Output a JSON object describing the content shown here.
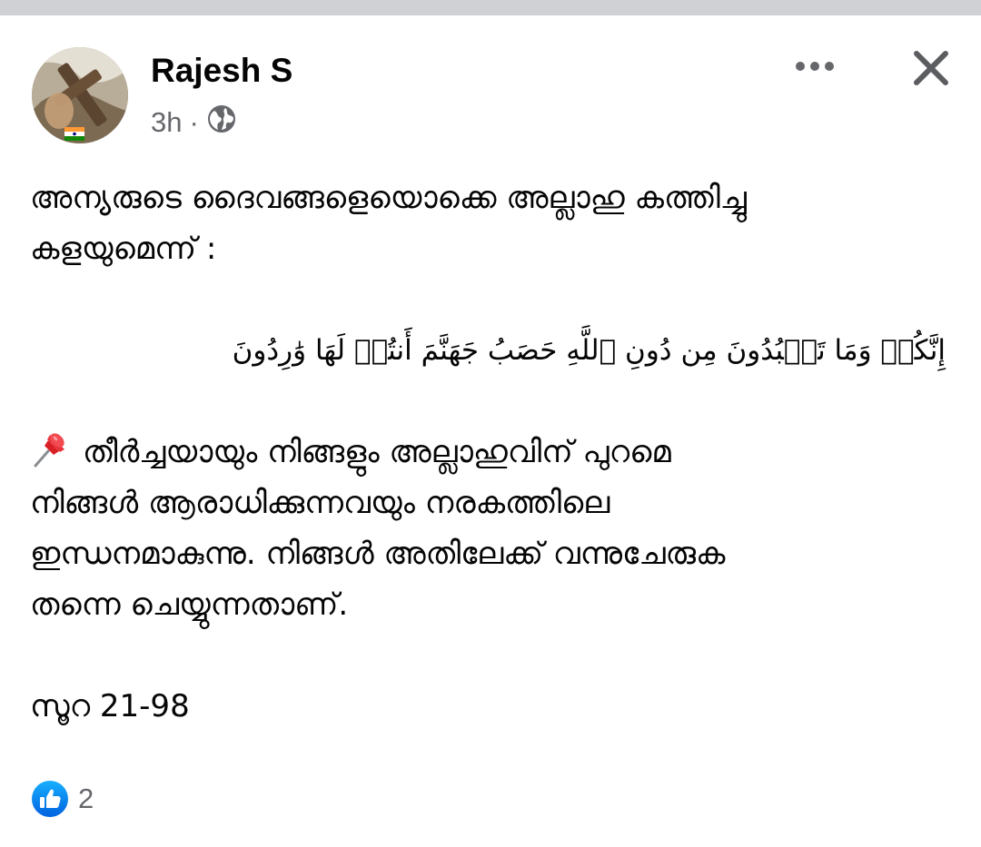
{
  "post": {
    "author": "Rajesh S",
    "time": "3h",
    "separator": "·",
    "audience_icon": "globe-icon",
    "paragraphs": {
      "intro_line1": "അന്യരുടെ ദൈവങ്ങളെയൊക്കെ അല്ലാഹു കത്തിച്ചു",
      "intro_line2": "കളയുമെന്ന് :",
      "arabic": "إِنَّكُمۡ وَمَا تَعۡبُدُونَ مِن دُونِ ٱللَّهِ حَصَبُ جَهَنَّمَ أَنتُمۡ لَهَا وَٰرِدُونَ",
      "pin_icon": "pushpin-icon",
      "translation_line1": "തീർച്ചയായും നിങ്ങളും അല്ലാഹുവിന് പുറമെ",
      "translation_line2": "നിങ്ങൾ ആരാധിക്കുന്നവയും നരകത്തിലെ",
      "translation_line3": "ഇന്ധനമാകുന്നു. നിങ്ങൾ അതിലേക്ക് വന്നുചേരുക",
      "translation_line4": "തന്നെ ചെയ്യുന്നതാണ്.",
      "reference": "സൂറ 21-98"
    }
  },
  "header_actions": {
    "more_icon": "more-options-icon",
    "close_icon": "close-icon"
  },
  "reactions": {
    "icon": "like-icon",
    "count": "2"
  },
  "colors": {
    "like_blue": "#1877f2",
    "secondary_text": "#65676b",
    "primary_text": "#050505",
    "top_strip": "#cfd1d4"
  }
}
